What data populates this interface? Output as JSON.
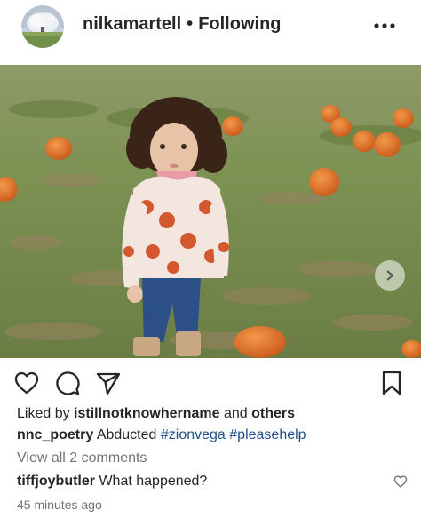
{
  "post": {
    "username": "nilkamartell",
    "separator": "•",
    "follow_status": "Following",
    "more_icon": "more-horizontal-icon"
  },
  "actions": {
    "like_icon": "heart-icon",
    "comment_icon": "comment-icon",
    "share_icon": "send-icon",
    "save_icon": "bookmark-icon",
    "next_icon": "chevron-right-icon"
  },
  "likes": {
    "prefix": "Liked by",
    "user": "istillnotknowhername",
    "and": "and",
    "others": "others"
  },
  "caption": {
    "username": "nnc_poetry",
    "text": "Abducted",
    "tag1": "#zionvega",
    "tag2": "#pleasehelp"
  },
  "comments": {
    "view_all": "View all 2 comments",
    "username": "tiffjoybutler",
    "text": "What happened?"
  },
  "timestamp": "45 minutes ago"
}
